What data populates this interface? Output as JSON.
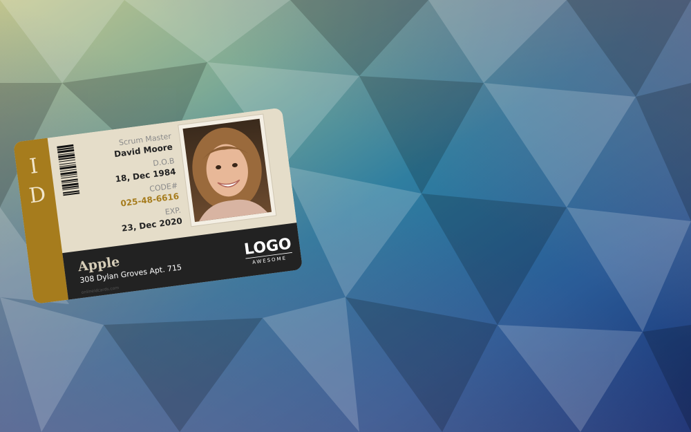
{
  "card": {
    "side_label_top": "I",
    "side_label_bottom": "D",
    "role": "Scrum Master",
    "name": "David Moore",
    "dob_label": "D.O.B",
    "dob_value": "18, Dec 1984",
    "code_label": "CODE#",
    "code_value": "025-48-6616",
    "exp_label": "EXP.",
    "exp_value": "23, Dec 2020",
    "company": "Apple",
    "address": "308 Dylan Groves Apt. 715",
    "logo_main": "LOGO",
    "logo_sub": "AWESOME",
    "watermark": "onlineidcards.com",
    "photo_icon": "portrait-photo"
  },
  "colors": {
    "gold": "#a67c1d",
    "card_bg": "#e5ddc9",
    "dark_band": "#222222",
    "code_color": "#a67c1d"
  }
}
